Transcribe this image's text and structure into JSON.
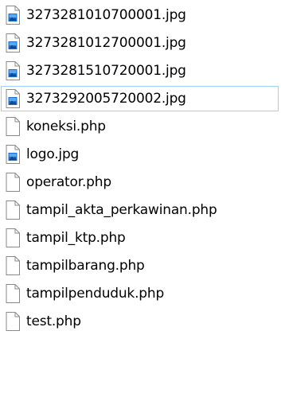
{
  "files": [
    {
      "name": "3273281010700001.jpg",
      "icon": "image-file-icon",
      "selected": false
    },
    {
      "name": "3273281012700001.jpg",
      "icon": "image-file-icon",
      "selected": false
    },
    {
      "name": "3273281510720001.jpg",
      "icon": "image-file-icon",
      "selected": false
    },
    {
      "name": "3273292005720002.jpg",
      "icon": "image-file-icon",
      "selected": true
    },
    {
      "name": "koneksi.php",
      "icon": "blank-file-icon",
      "selected": false
    },
    {
      "name": "logo.jpg",
      "icon": "image-file-icon",
      "selected": false
    },
    {
      "name": "operator.php",
      "icon": "blank-file-icon",
      "selected": false
    },
    {
      "name": "tampil_akta_perkawinan.php",
      "icon": "blank-file-icon",
      "selected": false
    },
    {
      "name": "tampil_ktp.php",
      "icon": "blank-file-icon",
      "selected": false
    },
    {
      "name": "tampilbarang.php",
      "icon": "blank-file-icon",
      "selected": false
    },
    {
      "name": "tampilpenduduk.php",
      "icon": "blank-file-icon",
      "selected": false
    },
    {
      "name": "test.php",
      "icon": "blank-file-icon",
      "selected": false
    }
  ],
  "colors": {
    "selection_border": "#99d1ff",
    "image_icon_blue": "#1a6fd1",
    "file_outline": "#8a8a8a"
  }
}
